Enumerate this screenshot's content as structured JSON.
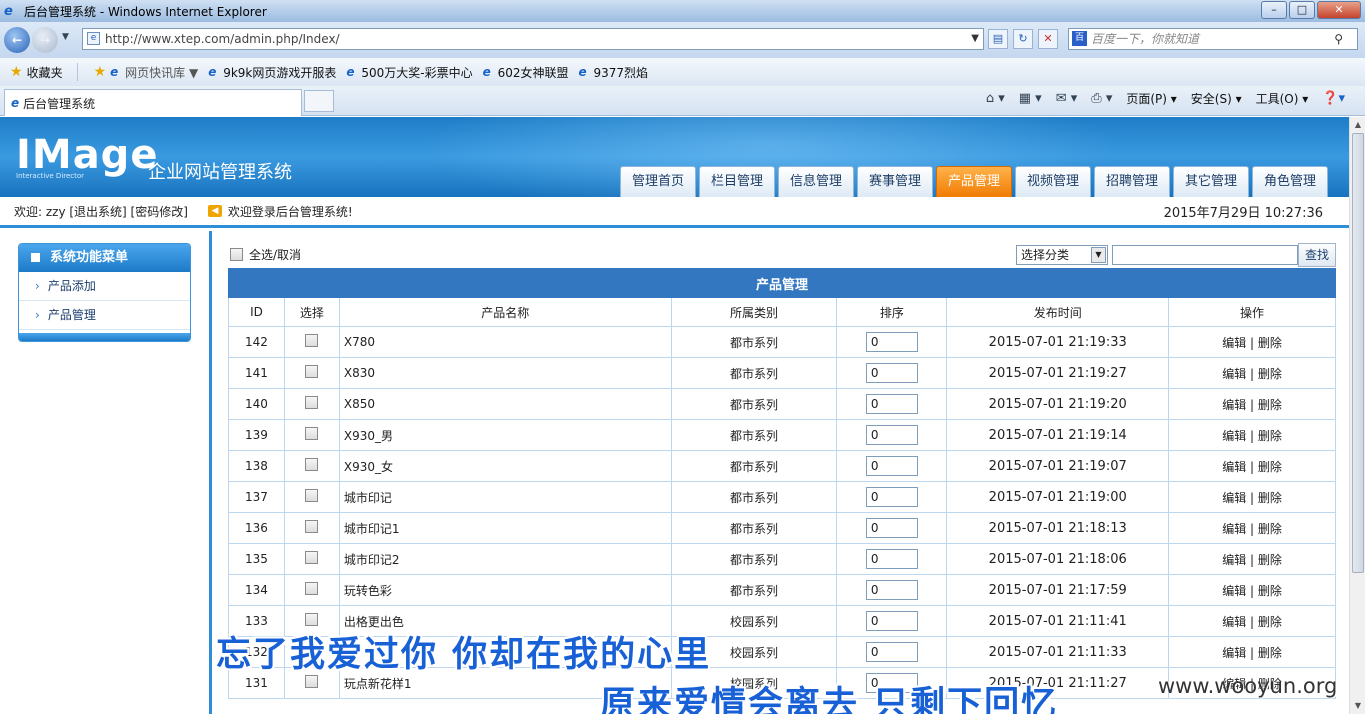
{
  "browser": {
    "window_title": "后台管理系统 - Windows Internet Explorer",
    "url": "http://www.xtep.com/admin.php/Index/",
    "search_placeholder": "百度一下，你就知道",
    "favorites_label": "收藏夹",
    "favorites": [
      "网页快讯库 ▼",
      "9k9k网页游戏开服表",
      "500万大奖-彩票中心",
      "602女神联盟",
      "9377烈焰"
    ],
    "tab_title": "后台管理系统",
    "commands": [
      "页面(P) ▾",
      "安全(S) ▾",
      "工具(O) ▾"
    ]
  },
  "header": {
    "logo": "IMage",
    "logo_sub": "Interactive Director",
    "system_title": "企业网站管理系统",
    "nav_tabs": [
      "管理首页",
      "栏目管理",
      "信息管理",
      "赛事管理",
      "产品管理",
      "视频管理",
      "招聘管理",
      "其它管理",
      "角色管理"
    ],
    "active_tab": "产品管理"
  },
  "infobar": {
    "welcome": "欢迎: zzy [退出系统] [密码修改]",
    "notice": "欢迎登录后台管理系统!",
    "datetime": "2015年7月29日 10:27:36"
  },
  "sidebar": {
    "title": "系统功能菜单",
    "items": [
      "产品添加",
      "产品管理"
    ]
  },
  "toolbar": {
    "select_all": "全选/取消",
    "category_select": "选择分类",
    "search_button": "查找"
  },
  "table": {
    "caption": "产品管理",
    "columns": [
      "ID",
      "选择",
      "产品名称",
      "所属类别",
      "排序",
      "发布时间",
      "操作"
    ],
    "rows": [
      {
        "id": "142",
        "name": "X780",
        "category": "都市系列",
        "sort": "0",
        "date": "2015-07-01 21:19:33"
      },
      {
        "id": "141",
        "name": "X830",
        "category": "都市系列",
        "sort": "0",
        "date": "2015-07-01 21:19:27"
      },
      {
        "id": "140",
        "name": "X850",
        "category": "都市系列",
        "sort": "0",
        "date": "2015-07-01 21:19:20"
      },
      {
        "id": "139",
        "name": "X930_男",
        "category": "都市系列",
        "sort": "0",
        "date": "2015-07-01 21:19:14"
      },
      {
        "id": "138",
        "name": "X930_女",
        "category": "都市系列",
        "sort": "0",
        "date": "2015-07-01 21:19:07"
      },
      {
        "id": "137",
        "name": "城市印记",
        "category": "都市系列",
        "sort": "0",
        "date": "2015-07-01 21:19:00"
      },
      {
        "id": "136",
        "name": "城市印记1",
        "category": "都市系列",
        "sort": "0",
        "date": "2015-07-01 21:18:13"
      },
      {
        "id": "135",
        "name": "城市印记2",
        "category": "都市系列",
        "sort": "0",
        "date": "2015-07-01 21:18:06"
      },
      {
        "id": "134",
        "name": "玩转色彩",
        "category": "都市系列",
        "sort": "0",
        "date": "2015-07-01 21:17:59"
      },
      {
        "id": "133",
        "name": "出格更出色",
        "category": "校园系列",
        "sort": "0",
        "date": "2015-07-01 21:11:41"
      },
      {
        "id": "132",
        "name": "",
        "category": "校园系列",
        "sort": "0",
        "date": "2015-07-01 21:11:33"
      },
      {
        "id": "131",
        "name": "玩点新花样1",
        "category": "校园系列",
        "sort": "0",
        "date": "2015-07-01 21:11:27"
      }
    ],
    "action_edit": "编辑",
    "action_sep": " | ",
    "action_delete": "删除"
  },
  "overlay": {
    "subtitle_line1": "忘了我爱过你  你却在我的心里",
    "subtitle_line2": "原来爱情会离去  只剩下回忆",
    "watermark": "www.wooyun.org"
  }
}
